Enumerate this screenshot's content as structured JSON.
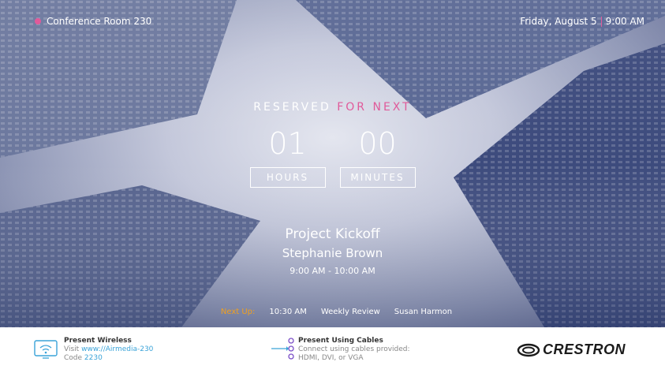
{
  "header": {
    "room_name": "Conference Room 230",
    "date": "Friday, August 5",
    "time": "9:00 AM",
    "status_color": "#e05a9a"
  },
  "status": {
    "reserved_label": "RESERVED",
    "reserved_accent": "FOR NEXT",
    "hours_value": "01",
    "minutes_value": "00",
    "hours_label": "HOURS",
    "minutes_label": "MINUTES"
  },
  "current_meeting": {
    "title": "Project Kickoff",
    "organizer": "Stephanie Brown",
    "time_range": "9:00 AM - 10:00 AM"
  },
  "next_up": {
    "label": "Next Up:",
    "time": "10:30 AM",
    "title": "Weekly Review",
    "organizer": "Susan Harmon"
  },
  "footer": {
    "wireless": {
      "heading": "Present Wireless",
      "visit_prefix": "Visit",
      "visit_url": "www://Airmedia-230",
      "code_prefix": "Code",
      "code_value": "2230",
      "icon": "wireless-screen-icon"
    },
    "cables": {
      "heading": "Present Using Cables",
      "line1": "Connect using cables provided:",
      "line2": "HDMI, DVI, or VGA",
      "icon": "cable-connector-icon"
    },
    "logo_text": "CRESTRON"
  }
}
